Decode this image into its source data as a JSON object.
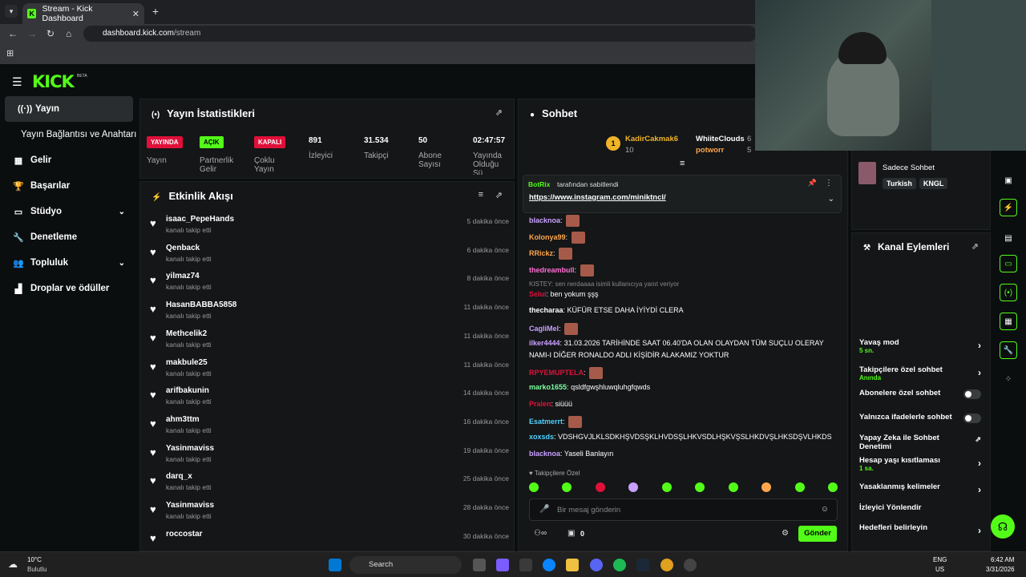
{
  "browser": {
    "tab_title": "Stream - Kick Dashboard",
    "url_host": "dashboard.kick.com",
    "url_path": "/stream"
  },
  "app": {
    "logo": "KICK",
    "logo_badge": "BETA"
  },
  "sidebar": {
    "items": [
      {
        "label": "Yayın",
        "icon": "broadcast-icon"
      },
      {
        "label": "Yayın Bağlantısı ve Anahtarı",
        "icon": ""
      },
      {
        "label": "Gelir",
        "icon": "money-icon"
      },
      {
        "label": "Başarılar",
        "icon": "trophy-icon"
      },
      {
        "label": "Stüdyo",
        "icon": "studio-icon"
      },
      {
        "label": "Denetleme",
        "icon": "wrench-icon"
      },
      {
        "label": "Topluluk",
        "icon": "community-icon"
      },
      {
        "label": "Droplar ve ödüller",
        "icon": "drops-icon"
      }
    ]
  },
  "stats": {
    "title": "Yayın İstatistikleri",
    "items": [
      {
        "badge": "YAYINDA",
        "label": "Yayın",
        "color": "#e0103a"
      },
      {
        "badge": "AÇIK",
        "label": "Partnerlik Gelir",
        "color": "#53fc18"
      },
      {
        "badge": "KAPALI",
        "label": "Çoklu Yayın",
        "color": "#e0103a"
      },
      {
        "value": "891",
        "label": "İzleyici"
      },
      {
        "value": "31.534",
        "label": "Takipçi"
      },
      {
        "value": "50",
        "label": "Abone Sayısı"
      },
      {
        "value": "02:47:57",
        "label": "Yayında Olduğu Sü"
      }
    ]
  },
  "events": {
    "title": "Etkinlik Akışı",
    "rows": [
      {
        "name": "isaac_PepeHands",
        "sub": "kanalı takip etti",
        "time": "5 dakika önce"
      },
      {
        "name": "Qenback",
        "sub": "kanalı takip etti",
        "time": "6 dakika önce"
      },
      {
        "name": "yilmaz74",
        "sub": "kanalı takip etti",
        "time": "8 dakika önce"
      },
      {
        "name": "HasanBABBA5858",
        "sub": "kanalı takip etti",
        "time": "11 dakika önce"
      },
      {
        "name": "Methcelik2",
        "sub": "kanalı takip etti",
        "time": "11 dakika önce"
      },
      {
        "name": "makbule25",
        "sub": "kanalı takip etti",
        "time": "11 dakika önce"
      },
      {
        "name": "arifbakunin",
        "sub": "kanalı takip etti",
        "time": "14 dakika önce"
      },
      {
        "name": "ahm3ttm",
        "sub": "kanalı takip etti",
        "time": "16 dakika önce"
      },
      {
        "name": "Yasinmaviss",
        "sub": "kanalı takip etti",
        "time": "19 dakika önce"
      },
      {
        "name": "darq_x",
        "sub": "kanalı takip etti",
        "time": "25 dakika önce"
      },
      {
        "name": "Yasinmaviss",
        "sub": "kanalı takip etti",
        "time": "28 dakika önce"
      },
      {
        "name": "roccostar",
        "sub": "",
        "time": "30 dakika önce"
      }
    ]
  },
  "chat": {
    "title": "Sohbet",
    "leaders": [
      {
        "name": "KadirCakmak6",
        "count": "10"
      },
      {
        "name": "WhiiteClouds",
        "count": "6"
      },
      {
        "name": "potworr",
        "count": "5"
      }
    ],
    "pinned": {
      "by": "BotRix",
      "label": "tarafından sabitlendi",
      "link": "https://www.instagram.com/miniktncl/"
    },
    "messages": [
      {
        "user": "blacknoa",
        "text": "",
        "color": "#c9a0ff",
        "emote": true
      },
      {
        "user": "Kolonya99",
        "text": "",
        "color": "#ffa64d",
        "emote": true
      },
      {
        "user": "RRickz",
        "text": "",
        "color": "#ffa64d",
        "emote": true
      },
      {
        "user": "thedreambull",
        "text": "",
        "color": "#ff6fd2",
        "emote": true
      },
      {
        "user": "Selui",
        "text": "ben yokum şşş",
        "color": "#e0103a",
        "emote": false
      },
      {
        "user": "thecharaa",
        "text": "KÜFÜR ETSE DAHA İYİYDİ CLERA",
        "color": "#fff",
        "emote": false
      },
      {
        "user": "CagliMel",
        "text": "",
        "color": "#c9a0ff",
        "emote": true
      },
      {
        "user": "ilker4444",
        "text": "31.03.2026 TARİHİNDE SAAT 06.40'DA OLAN OLAYDAN TÜM SUÇLU OLERAY",
        "color": "#c9a0ff",
        "emote": false
      },
      {
        "user": "RPYEMUPTELA",
        "text": "",
        "color": "#e0103a",
        "emote": true
      },
      {
        "user": "marko1655",
        "text": "qsldfgwşhluwqluhgfqwds",
        "color": "#7dffa0",
        "emote": false
      },
      {
        "user": "Pralen",
        "text": "siüüü",
        "color": "#e0103a",
        "emote": false
      },
      {
        "user": "Esatmerrt",
        "text": "",
        "color": "#4fd0ff",
        "emote": true
      },
      {
        "user": "xoxsds",
        "text": "VDSHGVJLKLSDKHŞVDSŞKLHVDSŞLHKVSDLHŞKVŞSLHKDVŞLHKSDŞVLHKDS",
        "color": "#4fd0ff",
        "emote": false
      },
      {
        "user": "blacknoa",
        "text": "Yaseli Banlayın",
        "color": "#c9a0ff",
        "emote": false
      }
    ],
    "reply_note": "KISTEY: sen nerdaaaa isimli kullanıcıya yanıt veriyor",
    "continuation": "NAMI-I DİĞER RONALDO ADLI KİŞİDİR ALAKAMIZ YOKTUR",
    "followers_only": "Takipçilere Özel",
    "input_placeholder": "Bir mesaj gönderin",
    "point_count": "0",
    "send_label": "Gönder"
  },
  "right_card": {
    "title_partial": "Sadece Sohbet",
    "chips": [
      "Turkish",
      "KNGL"
    ]
  },
  "channel_actions": {
    "title": "Kanal Eylemleri",
    "rows": [
      {
        "label": "Yavaş mod",
        "sub": "5 sn.",
        "kind": "chevron"
      },
      {
        "label": "Takipçilere özel sohbet",
        "sub": "Anında",
        "kind": "chevron"
      },
      {
        "label": "Abonelere özel sohbet",
        "sub": "",
        "kind": "toggle"
      },
      {
        "label": "Yalnızca ifadelerle sohbet",
        "sub": "",
        "kind": "toggle"
      },
      {
        "label": "Yapay Zeka ile Sohbet Denetimi",
        "sub": "",
        "kind": "external"
      },
      {
        "label": "Hesap yaşı kısıtlaması",
        "sub": "1 sa.",
        "kind": "chevron"
      },
      {
        "label": "Yasaklanmış kelimeler",
        "sub": "",
        "kind": "chevron"
      },
      {
        "label": "İzleyici Yönlendir",
        "sub": "",
        "kind": "none"
      },
      {
        "label": "Hedefleri belirleyin",
        "sub": "",
        "kind": "chevron"
      }
    ]
  },
  "taskbar": {
    "weather_temp": "10°C",
    "weather_desc": "Bulutlu",
    "search": "Search",
    "lang": "ENG",
    "region": "US",
    "time": "6:42 AM",
    "date": "3/31/2026"
  }
}
